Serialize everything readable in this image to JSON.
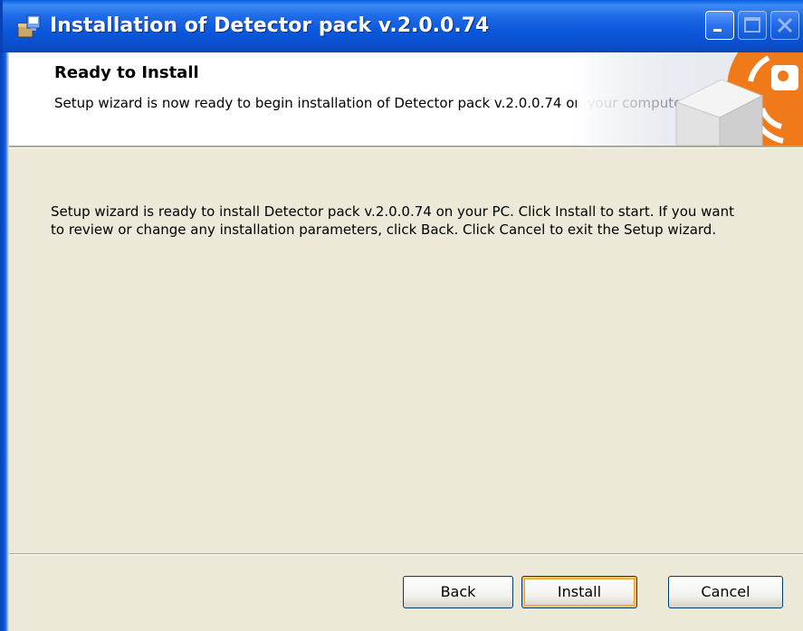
{
  "window": {
    "title": "Installation of Detector pack v.2.0.0.74",
    "icon": "installer-icon"
  },
  "titlebar_buttons": {
    "minimize": "minimize-icon",
    "maximize": "maximize-icon",
    "close": "close-icon"
  },
  "header": {
    "title": "Ready to Install",
    "description": "Setup wizard is now ready to begin installation of Detector pack v.2.0.0.74 on your computer."
  },
  "body": {
    "text": "Setup wizard is ready to install Detector pack v.2.0.0.74 on your PC. Click Install to start. If you want to review or change any installation parameters, click Back. Click Cancel to exit the Setup wizard."
  },
  "buttons": {
    "back": "Back",
    "install": "Install",
    "cancel": "Cancel"
  },
  "colors": {
    "titlebar": "#0A57DB",
    "window_bg": "#ECE9D8",
    "banner_bg": "#FFFFFF",
    "accent_orange": "#F07A1A",
    "default_button_focus": "#F9C15C"
  }
}
